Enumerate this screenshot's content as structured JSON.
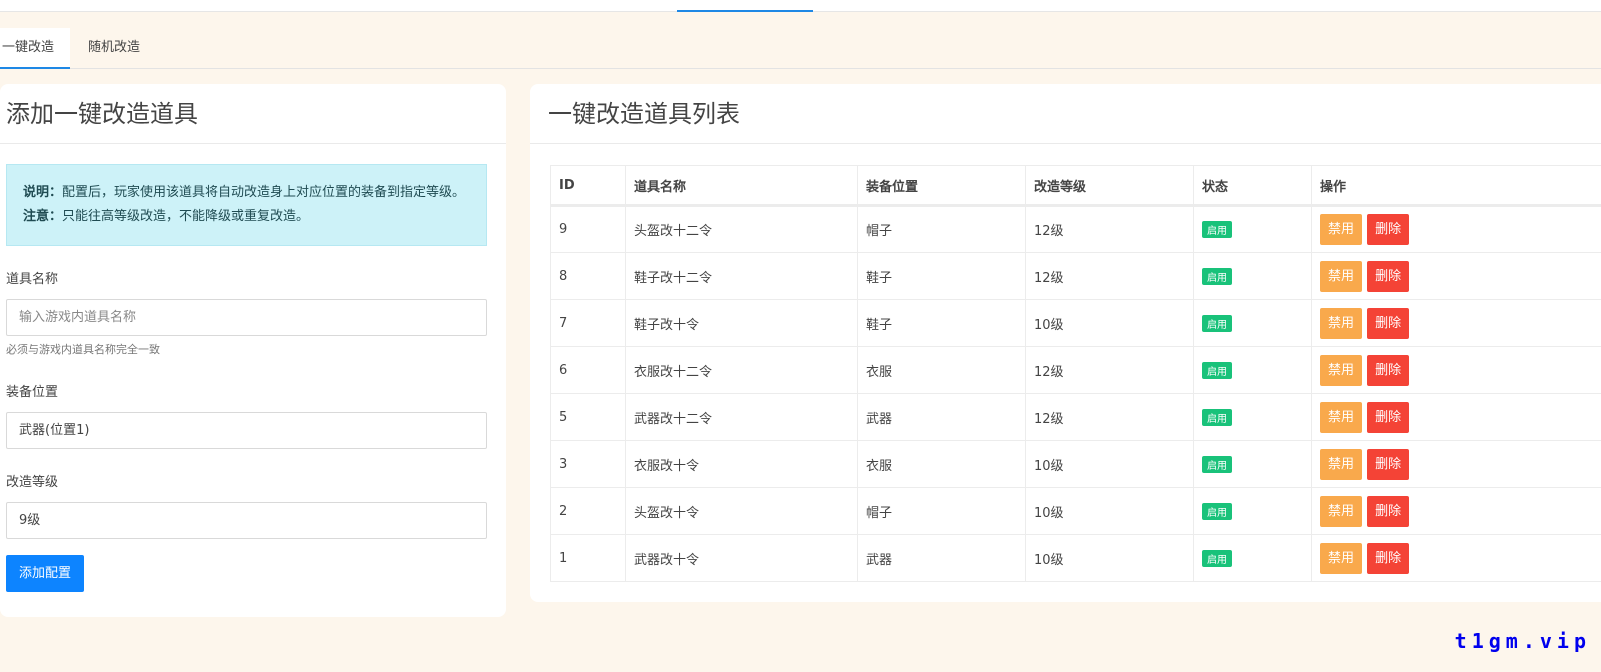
{
  "tabs": [
    "一键改造",
    "随机改造"
  ],
  "left": {
    "title": "添加一键改造道具",
    "note_label": "说明：",
    "note_text": "配置后，玩家使用该道具将自动改造身上对应位置的装备到指定等级。",
    "warn_label": "注意：",
    "warn_text": "只能往高等级改造，不能降级或重复改造。",
    "name_label": "道具名称",
    "name_placeholder": "输入游戏内道具名称",
    "name_help": "必须与游戏内道具名称完全一致",
    "pos_label": "装备位置",
    "pos_value": "武器(位置1)",
    "level_label": "改造等级",
    "level_value": "9级",
    "add_button": "添加配置"
  },
  "right": {
    "title": "一键改造道具列表",
    "columns": [
      "ID",
      "道具名称",
      "装备位置",
      "改造等级",
      "状态",
      "操作"
    ],
    "rows": [
      {
        "id": "9",
        "name": "头盔改十二令",
        "pos": "帽子",
        "level": "12级",
        "status": "启用"
      },
      {
        "id": "8",
        "name": "鞋子改十二令",
        "pos": "鞋子",
        "level": "12级",
        "status": "启用"
      },
      {
        "id": "7",
        "name": "鞋子改十令",
        "pos": "鞋子",
        "level": "10级",
        "status": "启用"
      },
      {
        "id": "6",
        "name": "衣服改十二令",
        "pos": "衣服",
        "level": "12级",
        "status": "启用"
      },
      {
        "id": "5",
        "name": "武器改十二令",
        "pos": "武器",
        "level": "12级",
        "status": "启用"
      },
      {
        "id": "3",
        "name": "衣服改十令",
        "pos": "衣服",
        "level": "10级",
        "status": "启用"
      },
      {
        "id": "2",
        "name": "头盔改十令",
        "pos": "帽子",
        "level": "10级",
        "status": "启用"
      },
      {
        "id": "1",
        "name": "武器改十令",
        "pos": "武器",
        "level": "10级",
        "status": "启用"
      }
    ],
    "disable_label": "禁用",
    "delete_label": "删除"
  },
  "watermark": "t1gm.vip"
}
